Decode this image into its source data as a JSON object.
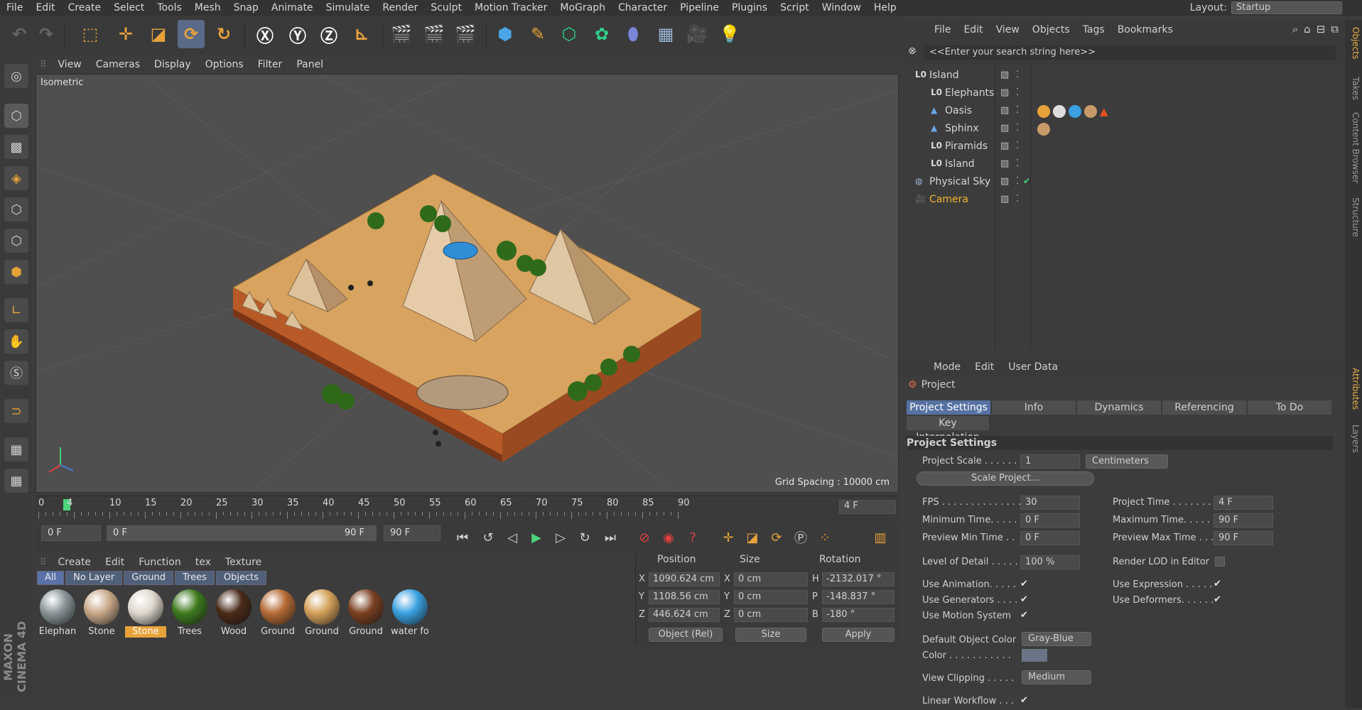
{
  "menubar": {
    "items": [
      "File",
      "Edit",
      "Create",
      "Select",
      "Tools",
      "Mesh",
      "Snap",
      "Animate",
      "Simulate",
      "Render",
      "Sculpt",
      "Motion Tracker",
      "MoGraph",
      "Character",
      "Pipeline",
      "Plugins",
      "Script",
      "Window",
      "Help"
    ],
    "layout_label": "Layout:",
    "layout_value": "Startup"
  },
  "viewport": {
    "menu": [
      "View",
      "Cameras",
      "Display",
      "Options",
      "Filter",
      "Panel"
    ],
    "label": "Isometric",
    "grid_spacing": "Grid Spacing : 10000 cm"
  },
  "timeline": {
    "ticks": [
      "0",
      "4",
      "10",
      "15",
      "20",
      "25",
      "30",
      "35",
      "40",
      "45",
      "50",
      "55",
      "60",
      "65",
      "70",
      "75",
      "80",
      "85",
      "90"
    ],
    "current_frame": "4 F"
  },
  "transport": {
    "start": "0 F",
    "range_start": "0 F",
    "range_end": "90 F",
    "end": "90 F"
  },
  "materials": {
    "menu": [
      "Create",
      "Edit",
      "Function",
      "tex",
      "Texture"
    ],
    "filters": [
      "All",
      "No Layer",
      "Ground",
      "Trees",
      "Objects"
    ],
    "items": [
      {
        "name": "Elephan",
        "color": "#8a9599"
      },
      {
        "name": "Stone",
        "color": "#c9a98a"
      },
      {
        "name": "Stone",
        "color": "#ded7cd",
        "selected": true
      },
      {
        "name": "Trees",
        "color": "#3d7a1d"
      },
      {
        "name": "Wood",
        "color": "#4a2a18"
      },
      {
        "name": "Ground",
        "color": "#b56a34"
      },
      {
        "name": "Ground",
        "color": "#d4a15a"
      },
      {
        "name": "Ground",
        "color": "#7a4020"
      },
      {
        "name": "water fo",
        "color": "#3aa0e0"
      }
    ]
  },
  "coords": {
    "headers": [
      "Position",
      "Size",
      "Rotation"
    ],
    "rows": [
      {
        "axis": "X",
        "pos": "1090.624 cm",
        "size_axis": "X",
        "size": "0 cm",
        "rot_axis": "H",
        "rot": "-2132.017 °"
      },
      {
        "axis": "Y",
        "pos": "1108.56 cm",
        "size_axis": "Y",
        "size": "0 cm",
        "rot_axis": "P",
        "rot": "-148.837 °"
      },
      {
        "axis": "Z",
        "pos": "446.624 cm",
        "size_axis": "Z",
        "size": "0 cm",
        "rot_axis": "B",
        "rot": "-180 °"
      }
    ],
    "mode": "Object (Rel)",
    "size_mode": "Size",
    "apply": "Apply"
  },
  "objects": {
    "menu": [
      "File",
      "Edit",
      "View",
      "Objects",
      "Tags",
      "Bookmarks"
    ],
    "search": "<<Enter your search string here>>",
    "items": [
      {
        "name": "Island",
        "indent": 0,
        "icon": "null"
      },
      {
        "name": "Elephants",
        "indent": 1,
        "icon": "null"
      },
      {
        "name": "Oasis",
        "indent": 1,
        "icon": "poly"
      },
      {
        "name": "Sphinx",
        "indent": 1,
        "icon": "poly"
      },
      {
        "name": "Piramids",
        "indent": 1,
        "icon": "null"
      },
      {
        "name": "Island",
        "indent": 1,
        "icon": "null"
      },
      {
        "name": "Physical Sky",
        "indent": 0,
        "icon": "sky"
      },
      {
        "name": "Camera",
        "indent": 0,
        "icon": "camera",
        "highlight": true
      }
    ]
  },
  "attributes": {
    "menu": [
      "Mode",
      "Edit",
      "User Data"
    ],
    "title": "Project",
    "tabs": [
      "Project Settings",
      "Info",
      "Dynamics",
      "Referencing",
      "To Do"
    ],
    "subtab": "Key Interpolation",
    "section": "Project Settings",
    "project_scale_label": "Project Scale . . . . . .",
    "project_scale": "1",
    "units": "Centimeters",
    "scale_button": "Scale Project...",
    "fps_label": "FPS . . . . . . . . . . . . . .",
    "fps": "30",
    "project_time_label": "Project Time . . . . . . . .",
    "project_time": "4 F",
    "min_time_label": "Minimum Time. . . . .",
    "min_time": "0 F",
    "max_time_label": "Maximum Time. . . . .",
    "max_time": "90 F",
    "prev_min_label": "Preview Min Time . .",
    "prev_min": "0 F",
    "prev_max_label": "Preview Max Time . . .",
    "prev_max": "90 F",
    "lod_label": "Level of Detail . . . . .",
    "lod": "100 %",
    "render_lod_label": "Render LOD in Editor",
    "use_animation": "Use Animation. . . . .",
    "use_expression": "Use Expression . . . . .",
    "use_generators": "Use Generators . . . .",
    "use_deformers": "Use Deformers. . . . . .",
    "use_motion": "Use Motion System",
    "default_color_label": "Default Object Color",
    "default_color": "Gray-Blue",
    "color_label": "Color . . . . . . . . . . .",
    "view_clipping_label": "View Clipping . . . . .",
    "view_clipping": "Medium",
    "linear_workflow": "Linear Workflow . . ."
  },
  "sidetabs": [
    "Objects",
    "Takes",
    "Content Browser",
    "Structure",
    "Attributes",
    "Layers"
  ],
  "maxon": "MAXON CINEMA 4D"
}
